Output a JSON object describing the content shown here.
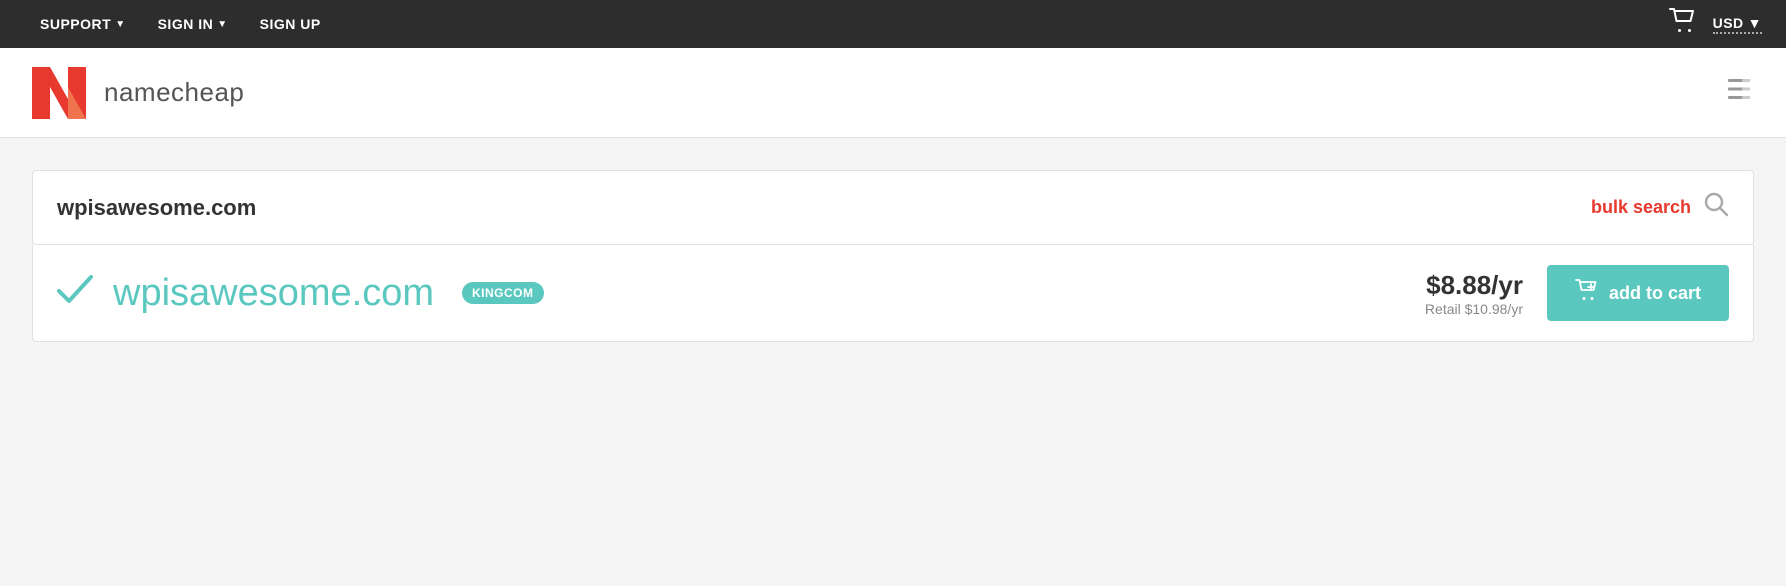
{
  "topnav": {
    "support_label": "SUPPORT",
    "signin_label": "SIGN IN",
    "signup_label": "SIGN UP",
    "currency_label": "USD"
  },
  "header": {
    "logo_text": "namecheap",
    "hamburger_label": "☰"
  },
  "search": {
    "domain_value": "wpisawesome.com",
    "bulk_search_label": "bulk search",
    "search_icon": "🔍"
  },
  "result": {
    "domain_name": "wpisawesome.com",
    "badge_label": "KINGCOM",
    "price_main": "$8.88/yr",
    "price_retail": "Retail $10.98/yr",
    "add_to_cart_label": "add to cart"
  }
}
